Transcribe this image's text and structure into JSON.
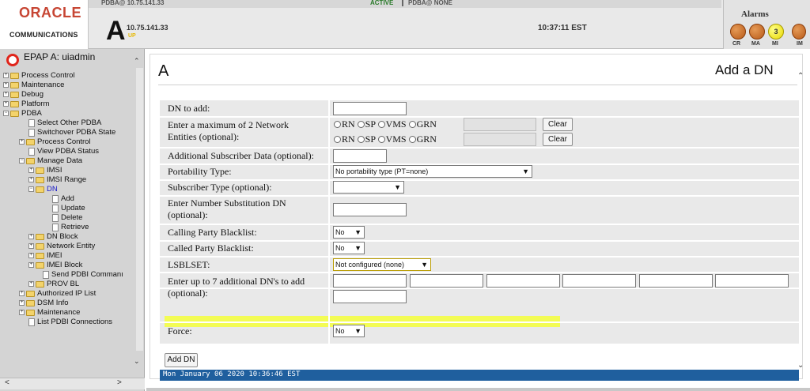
{
  "header": {
    "brand": "ORACLE",
    "brand_sub": "COMMUNICATIONS",
    "top_host": "PDBA@ 10.75.141.33",
    "top_active": "ACTIVE",
    "top_pdba": "PDBA@ NONE",
    "site_letter": "A",
    "host_ip": "10.75.141.33",
    "host_status": "UP",
    "clock": "10:37:11 EST",
    "alarms_title": "Alarms",
    "alarms": [
      {
        "code": "CR",
        "count": ""
      },
      {
        "code": "MA",
        "count": ""
      },
      {
        "code": "MI",
        "count": "3"
      },
      {
        "code": "IM",
        "count": ""
      }
    ]
  },
  "sidebar": {
    "title": "EPAP A: uiadmin",
    "scroll_up": "⌃",
    "scroll_down": "⌄",
    "scroll_left": "<",
    "scroll_right": ">",
    "tree": [
      {
        "label": "Process Control"
      },
      {
        "label": "Maintenance"
      },
      {
        "label": "Debug"
      },
      {
        "label": "Platform"
      },
      {
        "label": "PDBA"
      },
      {
        "label": "Select Other PDBA"
      },
      {
        "label": "Switchover PDBA State"
      },
      {
        "label": "Process Control"
      },
      {
        "label": "View PDBA Status"
      },
      {
        "label": "Manage Data"
      },
      {
        "label": "IMSI"
      },
      {
        "label": "IMSI Range"
      },
      {
        "label": "DN"
      },
      {
        "label": "Add"
      },
      {
        "label": "Update"
      },
      {
        "label": "Delete"
      },
      {
        "label": "Retrieve"
      },
      {
        "label": "DN Block"
      },
      {
        "label": "Network Entity"
      },
      {
        "label": "IMEI"
      },
      {
        "label": "IMEI Block"
      },
      {
        "label": "Send PDBI Commanı"
      },
      {
        "label": "PROV BL"
      },
      {
        "label": "Authorized IP List"
      },
      {
        "label": "DSM Info"
      },
      {
        "label": "Maintenance"
      },
      {
        "label": "List PDBI Connections"
      }
    ]
  },
  "main": {
    "letter": "A",
    "title": "Add a DN",
    "scroll_up": "⌃",
    "scroll_down": "⌄",
    "form": {
      "dn_to_add_label": "DN to add:",
      "network_entities_label": "Enter a maximum of 2 Network Entities (optional):",
      "radio_options": [
        "RN",
        "SP",
        "VMS",
        "GRN"
      ],
      "clear_label": "Clear",
      "additional_subscriber_label": "Additional Subscriber Data (optional):",
      "portability_label": "Portability Type:",
      "portability_value": "No portability type (PT=none)",
      "subscriber_type_label": "Subscriber Type (optional):",
      "subscriber_type_value": "",
      "number_substitution_label": "Enter Number Substitution DN (optional):",
      "calling_blacklist_label": "Calling Party Blacklist:",
      "calling_blacklist_value": "No",
      "called_blacklist_label": "Called Party Blacklist:",
      "called_blacklist_value": "No",
      "lsblset_label": "LSBLSET:",
      "lsblset_value": "Not configured (none)",
      "additional_dns_label": "Enter up to 7 additional DN's to add (optional):",
      "force_label": "Force:",
      "force_value": "No"
    },
    "submit_label": "Add DN",
    "status_time": "Mon January 06 2020 10:36:46 EST"
  }
}
